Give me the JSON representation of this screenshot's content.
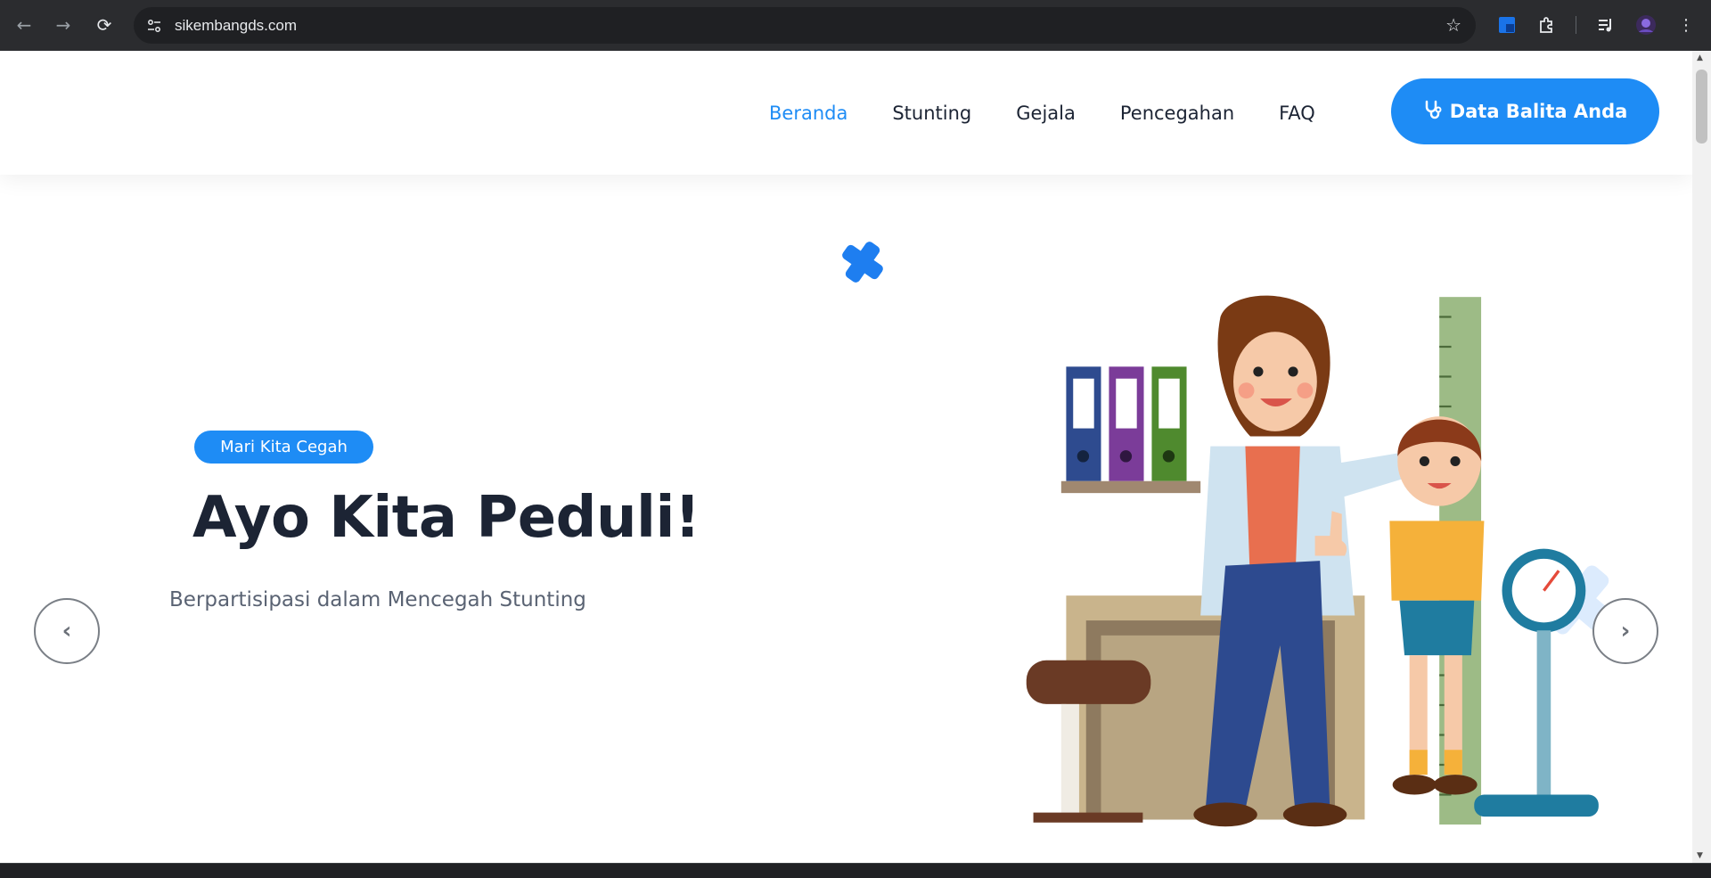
{
  "browser": {
    "url": "sikembangds.com",
    "icons": {
      "back": "back-arrow-icon",
      "forward": "forward-arrow-icon",
      "reload": "reload-icon",
      "site_info": "tune-icon",
      "bookmark": "star-icon",
      "extension_app": "app-extension-icon",
      "extensions": "puzzle-icon",
      "media": "media-queue-icon",
      "profile": "profile-avatar-icon",
      "menu": "kebab-menu-icon"
    }
  },
  "header": {
    "nav": [
      {
        "label": "Beranda",
        "active": true
      },
      {
        "label": "Stunting",
        "active": false
      },
      {
        "label": "Gejala",
        "active": false
      },
      {
        "label": "Pencegahan",
        "active": false
      },
      {
        "label": "FAQ",
        "active": false
      }
    ],
    "cta_label": "Data Balita Anda",
    "cta_icon": "stethoscope-icon"
  },
  "hero": {
    "badge": "Mari Kita Cegah",
    "title": "Ayo Kita Peduli!",
    "subtitle": "Berpartisipasi dalam Mencegah Stunting",
    "prev_icon": "chevron-left-icon",
    "next_icon": "chevron-right-icon"
  },
  "colors": {
    "accent": "#1e8cf5",
    "text_dark": "#1c2434",
    "text_muted": "#5a6373",
    "chrome_bg": "#2b2c2f"
  }
}
